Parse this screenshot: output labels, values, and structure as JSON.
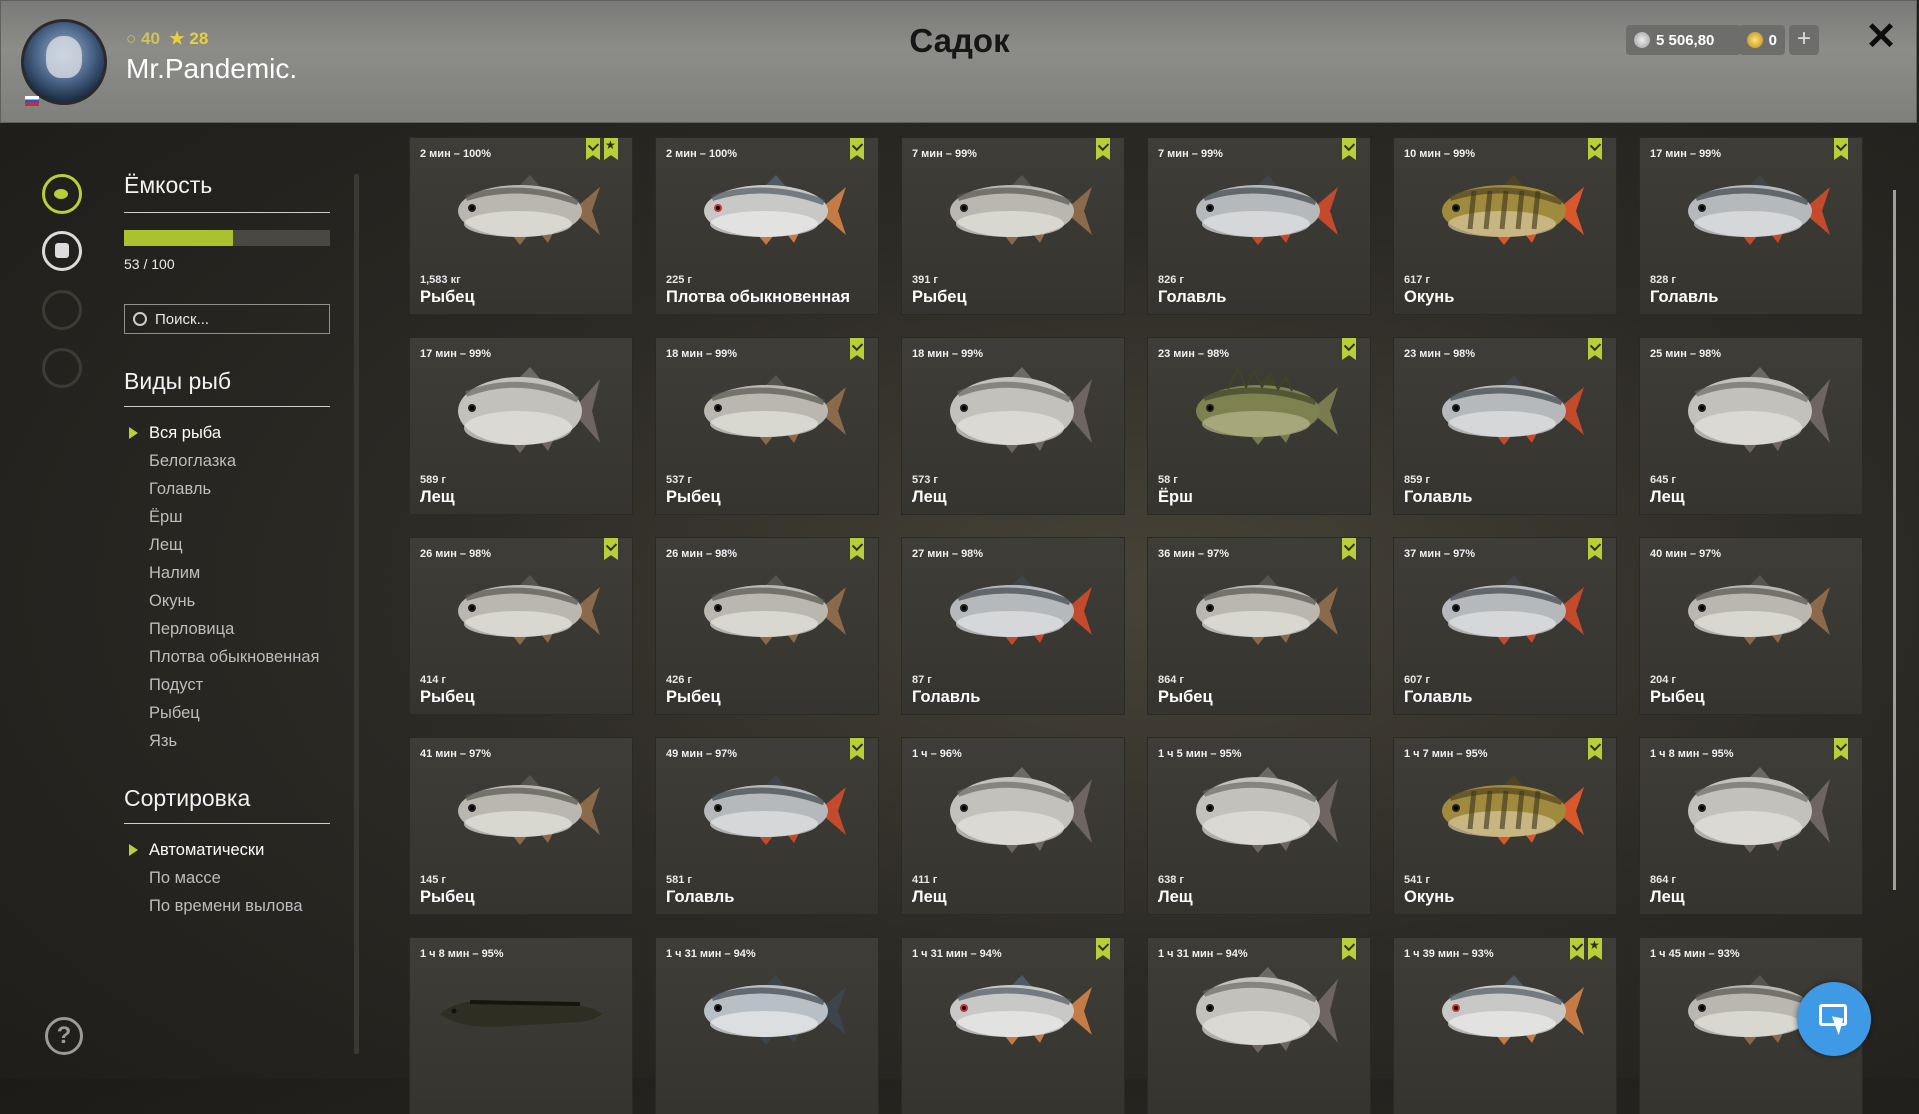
{
  "header": {
    "title": "Садок",
    "username": "Mr.Pandemic.",
    "stat_a": "40",
    "stat_b": "28",
    "silver": "5 506,80",
    "gold": "0",
    "plus_label": "+",
    "close_label": "✕"
  },
  "sidebar": {
    "capacity_title": "Ёмкость",
    "capacity_value": "53 / 100",
    "capacity_fraction": 0.53,
    "search_placeholder": "Поиск...",
    "species_title": "Виды рыб",
    "species": [
      "Вся рыба",
      "Белоглазка",
      "Голавль",
      "Ёрш",
      "Лещ",
      "Налим",
      "Окунь",
      "Перловица",
      "Плотва обыкновенная",
      "Подуст",
      "Рыбец",
      "Язь"
    ],
    "species_active": 0,
    "sort_title": "Сортировка",
    "sort_options": [
      "Автоматически",
      "По массе",
      "По времени вылова"
    ],
    "sort_active": 0,
    "help_label": "?"
  },
  "accent_color": "#b9cf3a",
  "fish": [
    {
      "time": "2 мин – 100%",
      "weight": "1,583 кг",
      "name": "Рыбец",
      "type": "rybets",
      "tags": [
        "check",
        "star"
      ]
    },
    {
      "time": "2 мин – 100%",
      "weight": "225 г",
      "name": "Плотва обыкновенная",
      "type": "plotva",
      "tags": [
        "check"
      ]
    },
    {
      "time": "7 мин – 99%",
      "weight": "391 г",
      "name": "Рыбец",
      "type": "rybets",
      "tags": [
        "check"
      ]
    },
    {
      "time": "7 мин – 99%",
      "weight": "826 г",
      "name": "Голавль",
      "type": "golavl",
      "tags": [
        "check"
      ]
    },
    {
      "time": "10 мин – 99%",
      "weight": "617 г",
      "name": "Окунь",
      "type": "okun",
      "tags": [
        "check"
      ]
    },
    {
      "time": "17 мин – 99%",
      "weight": "828 г",
      "name": "Голавль",
      "type": "golavl",
      "tags": [
        "check"
      ]
    },
    {
      "time": "17 мин – 99%",
      "weight": "589 г",
      "name": "Лещ",
      "type": "lesch",
      "tags": []
    },
    {
      "time": "18 мин – 99%",
      "weight": "537 г",
      "name": "Рыбец",
      "type": "rybets",
      "tags": [
        "check"
      ]
    },
    {
      "time": "18 мин – 99%",
      "weight": "573 г",
      "name": "Лещ",
      "type": "lesch",
      "tags": []
    },
    {
      "time": "23 мин – 98%",
      "weight": "58 г",
      "name": "Ёрш",
      "type": "yorsh",
      "tags": [
        "check"
      ]
    },
    {
      "time": "23 мин – 98%",
      "weight": "859 г",
      "name": "Голавль",
      "type": "golavl",
      "tags": [
        "check"
      ]
    },
    {
      "time": "25 мин – 98%",
      "weight": "645 г",
      "name": "Лещ",
      "type": "lesch",
      "tags": []
    },
    {
      "time": "26 мин – 98%",
      "weight": "414 г",
      "name": "Рыбец",
      "type": "rybets",
      "tags": [
        "check"
      ]
    },
    {
      "time": "26 мин – 98%",
      "weight": "426 г",
      "name": "Рыбец",
      "type": "rybets",
      "tags": [
        "check"
      ]
    },
    {
      "time": "27 мин – 98%",
      "weight": "87 г",
      "name": "Голавль",
      "type": "golavl",
      "tags": []
    },
    {
      "time": "36 мин – 97%",
      "weight": "864 г",
      "name": "Рыбец",
      "type": "rybets",
      "tags": [
        "check"
      ]
    },
    {
      "time": "37 мин – 97%",
      "weight": "607 г",
      "name": "Голавль",
      "type": "golavl",
      "tags": [
        "check"
      ]
    },
    {
      "time": "40 мин – 97%",
      "weight": "204 г",
      "name": "Рыбец",
      "type": "rybets",
      "tags": []
    },
    {
      "time": "41 мин – 97%",
      "weight": "145 г",
      "name": "Рыбец",
      "type": "rybets",
      "tags": []
    },
    {
      "time": "49 мин – 97%",
      "weight": "581 г",
      "name": "Голавль",
      "type": "golavl",
      "tags": [
        "check"
      ]
    },
    {
      "time": "1 ч – 96%",
      "weight": "411 г",
      "name": "Лещ",
      "type": "lesch",
      "tags": []
    },
    {
      "time": "1 ч 5 мин – 95%",
      "weight": "638 г",
      "name": "Лещ",
      "type": "lesch",
      "tags": []
    },
    {
      "time": "1 ч 7 мин – 95%",
      "weight": "541 г",
      "name": "Окунь",
      "type": "okun",
      "tags": [
        "check"
      ]
    },
    {
      "time": "1 ч 8 мин – 95%",
      "weight": "864 г",
      "name": "Лещ",
      "type": "lesch",
      "tags": [
        "check"
      ]
    },
    {
      "time": "1 ч 8 мин – 95%",
      "weight": "",
      "name": "",
      "type": "nalim",
      "tags": []
    },
    {
      "time": "1 ч 31 мин – 94%",
      "weight": "",
      "name": "",
      "type": "podust",
      "tags": []
    },
    {
      "time": "1 ч 31 мин – 94%",
      "weight": "",
      "name": "",
      "type": "plotva",
      "tags": [
        "check"
      ]
    },
    {
      "time": "1 ч 31 мин – 94%",
      "weight": "",
      "name": "",
      "type": "lesch",
      "tags": [
        "check"
      ]
    },
    {
      "time": "1 ч 39 мин – 93%",
      "weight": "",
      "name": "",
      "type": "plotva",
      "tags": [
        "check",
        "star"
      ]
    },
    {
      "time": "1 ч 45 мин – 93%",
      "weight": "",
      "name": "",
      "type": "rybets",
      "tags": []
    }
  ]
}
